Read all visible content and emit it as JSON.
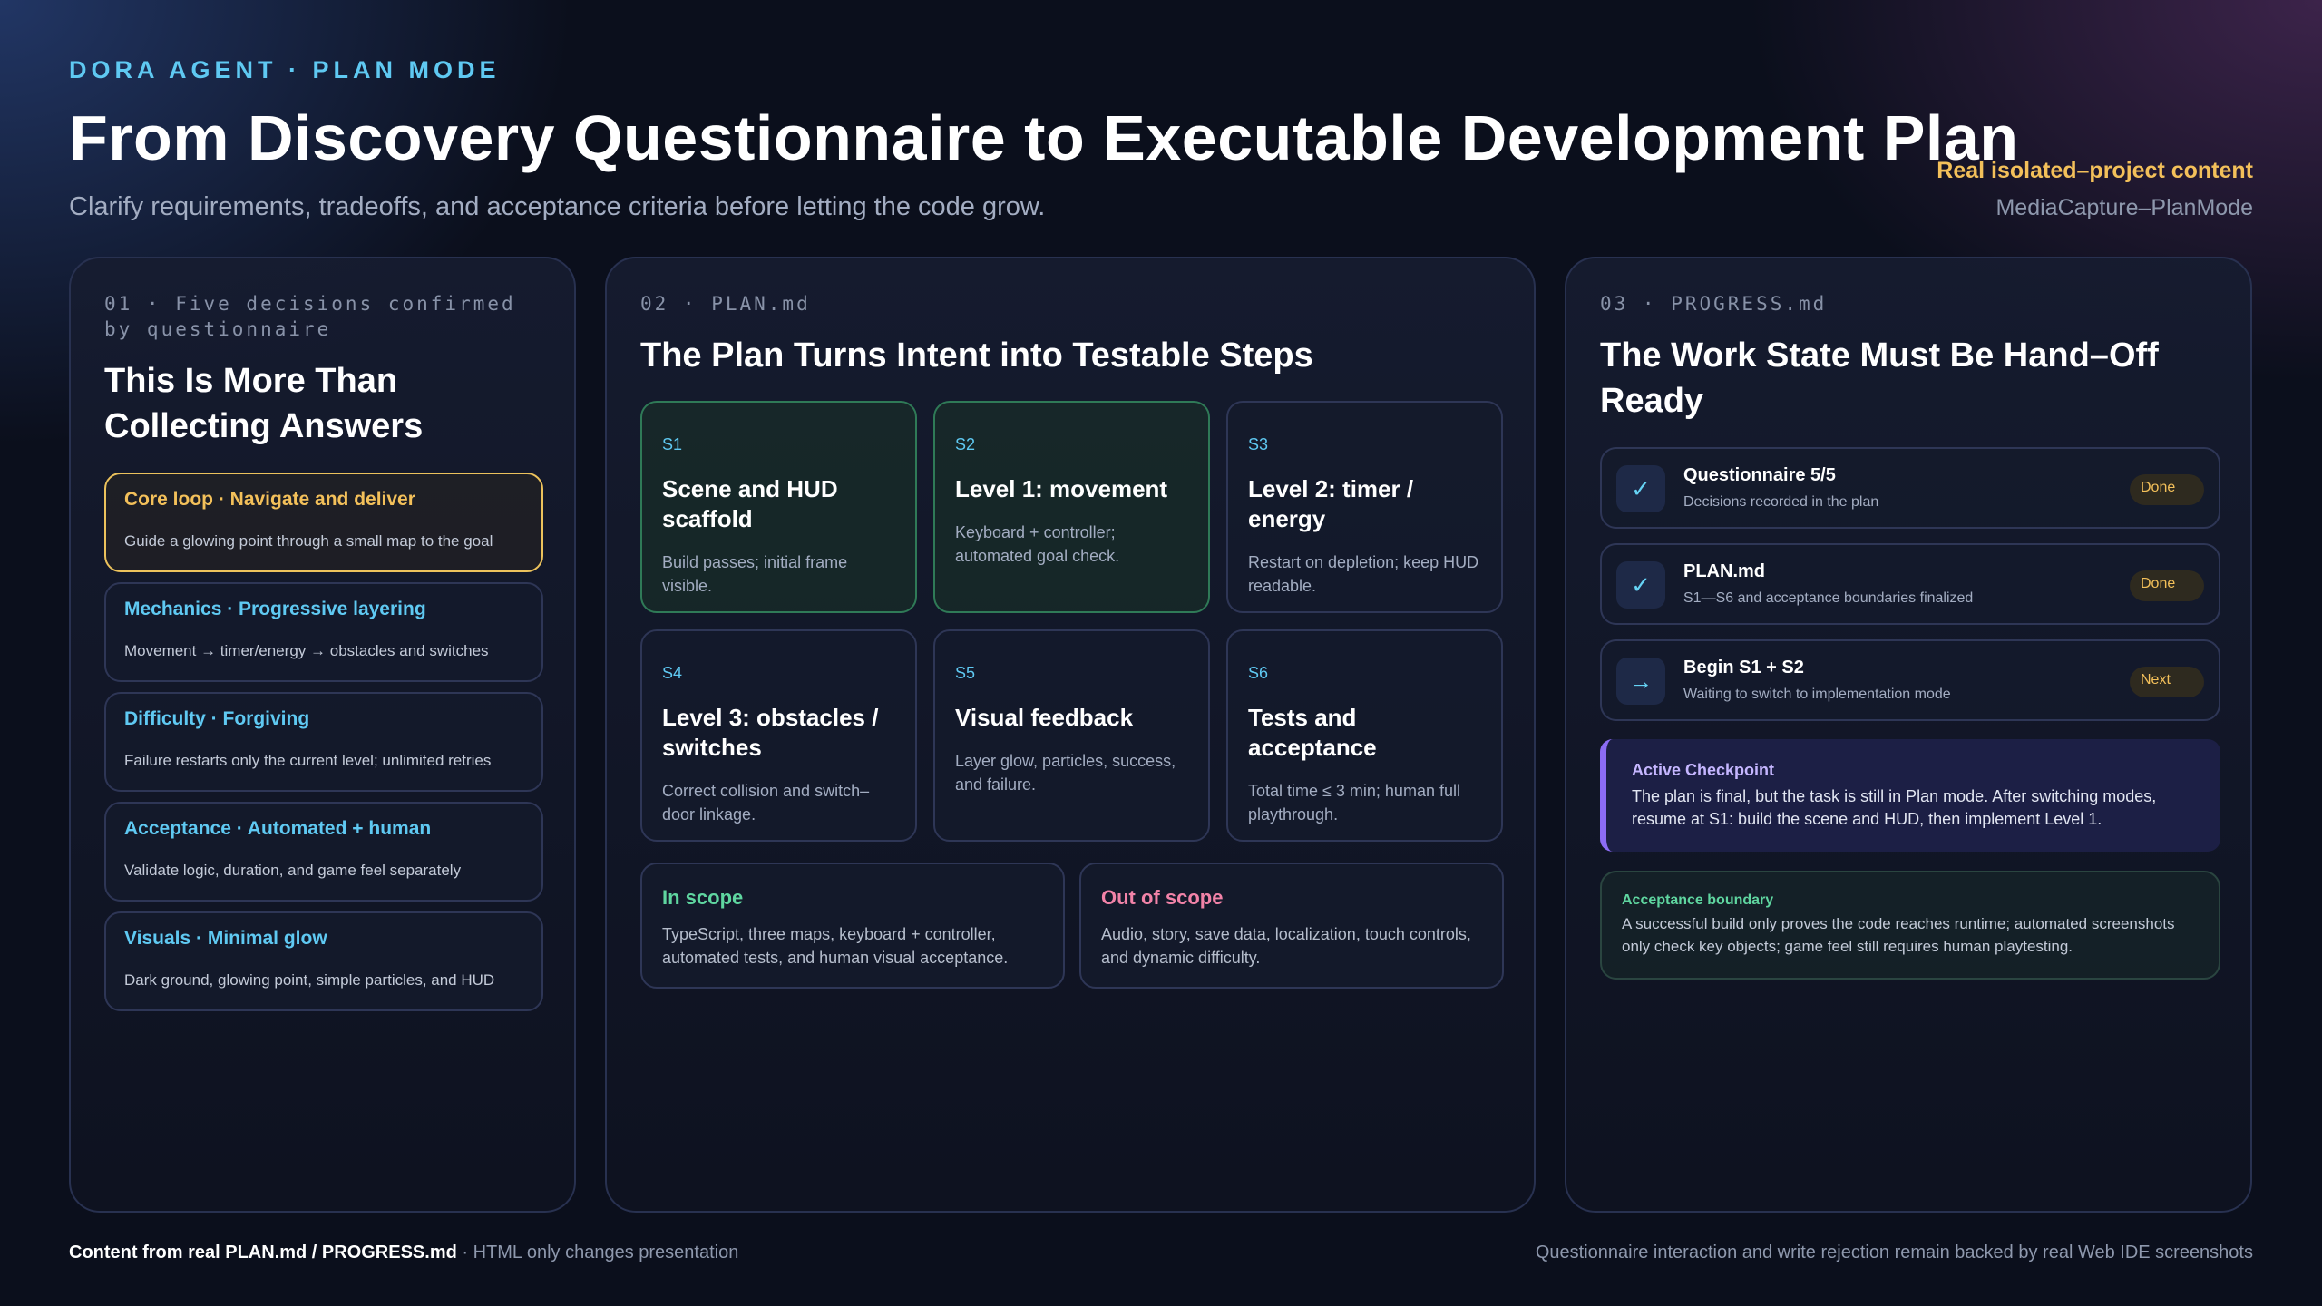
{
  "header": {
    "kicker": "DORA AGENT · PLAN MODE",
    "title": "From Discovery Questionnaire to Executable Development Plan",
    "subtitle": "Clarify requirements, tradeoffs, and acceptance criteria before letting the code grow.",
    "tag": "Real isolated–project content",
    "project": "MediaCapture–PlanMode"
  },
  "panel1": {
    "eyebrow": "01 · Five decisions confirmed by questionnaire",
    "title": "This Is More Than Collecting Answers",
    "decisions": [
      {
        "head": "Core loop · Navigate and deliver",
        "desc": "Guide a glowing point through a small map to the goal"
      },
      {
        "head": "Mechanics · Progressive layering",
        "desc": "Movement → timer/energy → obstacles and switches"
      },
      {
        "head": "Difficulty · Forgiving",
        "desc": "Failure restarts only the current level; unlimited retries"
      },
      {
        "head": "Acceptance · Automated + human",
        "desc": "Validate logic, duration, and game feel separately"
      },
      {
        "head": "Visuals · Minimal glow",
        "desc": "Dark ground, glowing point, simple particles, and HUD"
      }
    ]
  },
  "panel2": {
    "eyebrow": "02 · PLAN.md",
    "title": "The Plan Turns Intent into Testable Steps",
    "steps": [
      {
        "id": "S1",
        "name": "Scene and HUD scaffold",
        "desc": "Build passes; initial frame visible."
      },
      {
        "id": "S2",
        "name": "Level 1: movement",
        "desc": "Keyboard + controller; automated goal check."
      },
      {
        "id": "S3",
        "name": "Level 2: timer / energy",
        "desc": "Restart on depletion; keep HUD readable."
      },
      {
        "id": "S4",
        "name": "Level 3: obstacles / switches",
        "desc": "Correct collision and switch–door linkage."
      },
      {
        "id": "S5",
        "name": "Visual feedback",
        "desc": "Layer glow, particles, success, and failure."
      },
      {
        "id": "S6",
        "name": "Tests and acceptance",
        "desc": "Total time ≤ 3 min; human full playthrough."
      }
    ],
    "in_scope": {
      "head": "In scope",
      "desc": "TypeScript, three maps, keyboard + controller, automated tests, and human visual acceptance."
    },
    "out_scope": {
      "head": "Out of scope",
      "desc": "Audio, story, save data, localization, touch controls, and dynamic difficulty."
    }
  },
  "panel3": {
    "eyebrow": "03 · PROGRESS.md",
    "title": "The Work State Must Be Hand–Off Ready",
    "tasks": [
      {
        "icon": "✓",
        "name": "Questionnaire 5/5",
        "sub": "Decisions recorded in the plan",
        "badge": "Done"
      },
      {
        "icon": "✓",
        "name": "PLAN.md",
        "sub": "S1—S6 and acceptance boundaries finalized",
        "badge": "Done"
      },
      {
        "icon": "→",
        "name": "Begin S1 + S2",
        "sub": "Waiting to switch to implementation mode",
        "badge": "Next"
      }
    ],
    "checkpoint": {
      "head": "Active Checkpoint",
      "desc": "The plan is final, but the task is still in Plan mode. After switching modes, resume at S1: build the scene and HUD, then implement Level 1."
    },
    "acceptance": {
      "head": "Acceptance boundary",
      "desc": "A successful build only proves the code reaches runtime; automated screenshots only check key objects; game feel still requires human playtesting."
    }
  },
  "footer": {
    "left_bold": "Content from real PLAN.md / PROGRESS.md",
    "left_rest": " · HTML only changes presentation",
    "right": "Questionnaire interaction and write rejection remain backed by real Web IDE screenshots"
  },
  "colors": {
    "accent_cyan": "#5fc9f2",
    "accent_gold": "#f3c05a",
    "accent_green": "#5fd6a0",
    "accent_pink": "#f283a8",
    "accent_violet": "#8c6cf5"
  }
}
